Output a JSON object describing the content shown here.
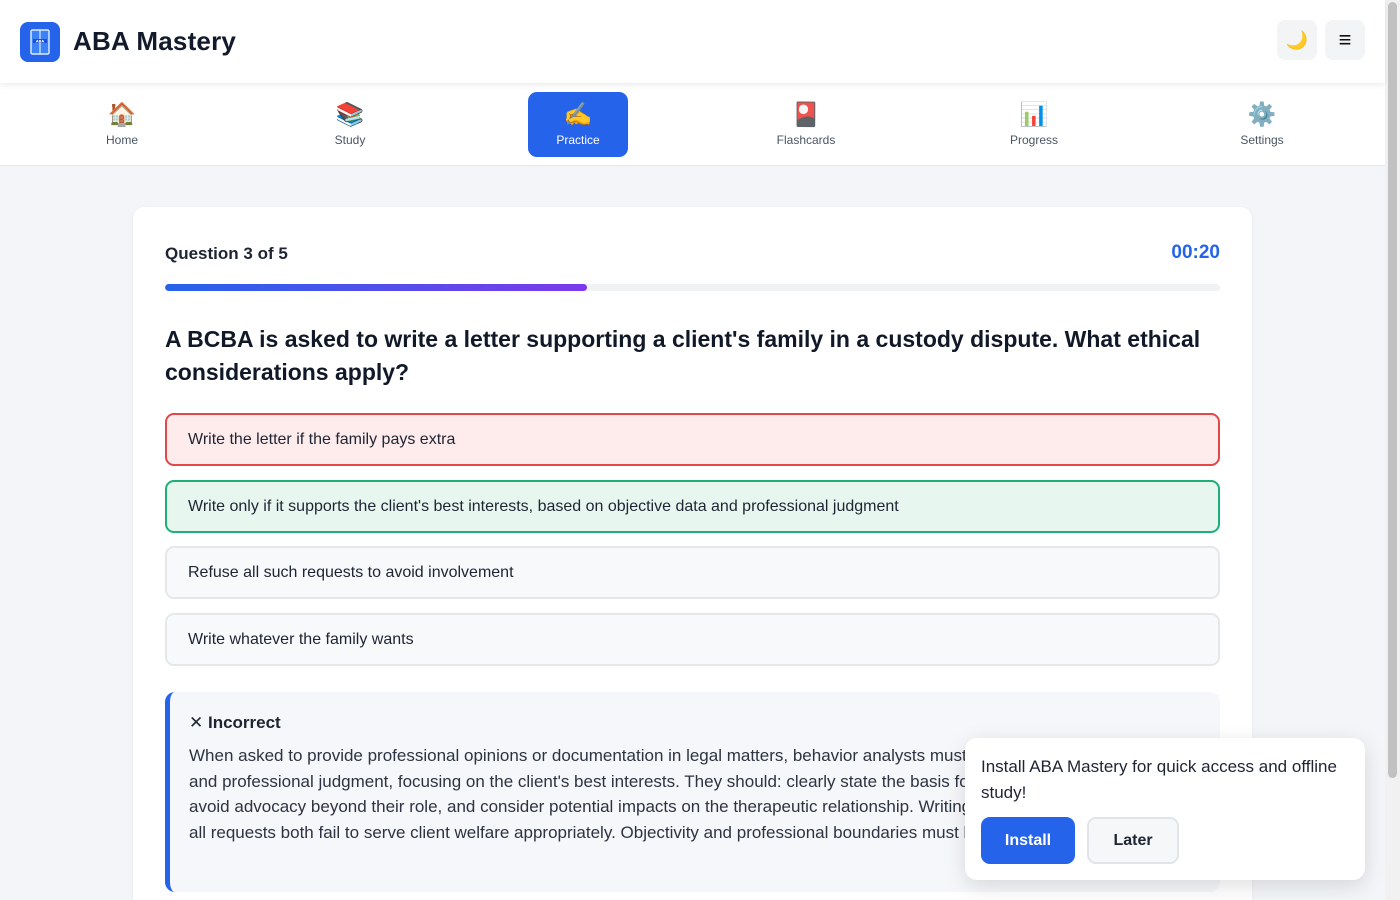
{
  "header": {
    "title": "ABA Mastery",
    "logo_icon": "book-icon",
    "theme_toggle_icon": "🌙",
    "menu_icon": "≡"
  },
  "nav": {
    "items": [
      {
        "label": "Home",
        "icon": "🏠",
        "active": false
      },
      {
        "label": "Study",
        "icon": "📚",
        "active": false
      },
      {
        "label": "Practice",
        "icon": "✍️",
        "active": true
      },
      {
        "label": "Flashcards",
        "icon": "🎴",
        "active": false
      },
      {
        "label": "Progress",
        "icon": "📊",
        "active": false
      },
      {
        "label": "Settings",
        "icon": "⚙️",
        "active": false
      }
    ]
  },
  "quiz": {
    "counter": "Question 3 of 5",
    "timer": "00:20",
    "progress_fraction": 0.4,
    "question": "A BCBA is asked to write a letter supporting a client's family in a custody dispute. What ethical considerations apply?",
    "options": [
      {
        "text": "Write the letter if the family pays extra",
        "state": "incorrect"
      },
      {
        "text": "Write only if it supports the client's best interests, based on objective data and professional judgment",
        "state": "correct"
      },
      {
        "text": "Refuse all such requests to avoid involvement",
        "state": "neutral"
      },
      {
        "text": "Write whatever the family wants",
        "state": "neutral"
      }
    ]
  },
  "feedback": {
    "title": "✕ Incorrect",
    "text": "When asked to provide professional opinions or documentation in legal matters, behavior analysts must base them on objective data and professional judgment, focusing on the client's best interests. They should: clearly state the basis for opinions and their limitations, avoid advocacy beyond their role, and consider potential impacts on the therapeutic relationship. Writing what families want or refusing all requests both fail to serve client welfare appropriately. Objectivity and professional boundaries must be maintained."
  },
  "install_prompt": {
    "message": "Install ABA Mastery for quick access and offline study!",
    "install_label": "Install",
    "later_label": "Later"
  },
  "colors": {
    "accent": "#2563eb",
    "incorrect_border": "#e24848",
    "correct_border": "#1fae78"
  }
}
